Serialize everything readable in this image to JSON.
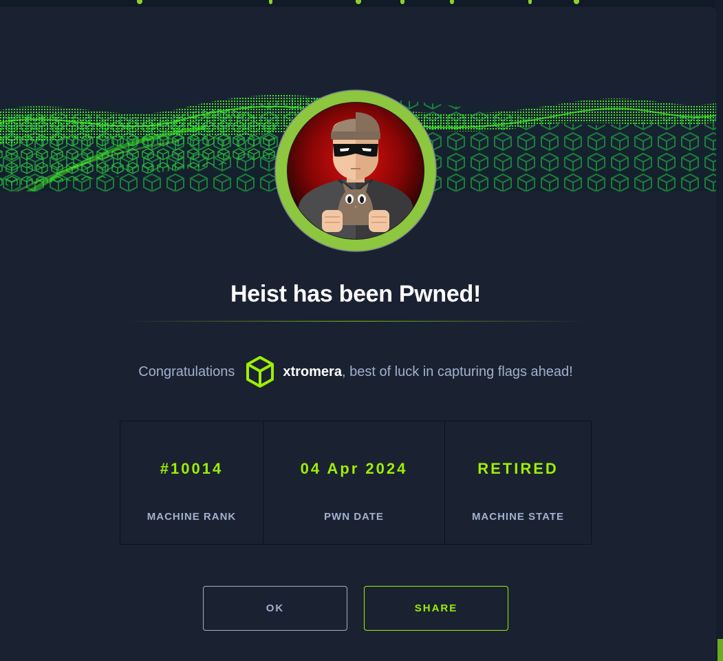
{
  "modal": {
    "title": "Heist has been Pwned!",
    "congrats_prefix": "Congratulations",
    "username": "xtromera",
    "congrats_suffix": ", best of luck in capturing flags ahead!"
  },
  "stats": [
    {
      "value": "#10014",
      "label": "MACHINE RANK"
    },
    {
      "value": "04 Apr 2024",
      "label": "PWN DATE"
    },
    {
      "value": "RETIRED",
      "label": "MACHINE STATE"
    }
  ],
  "buttons": {
    "ok_label": "OK",
    "share_label": "SHARE"
  },
  "icons": {
    "banner": "green-cube-wave-banner",
    "avatar": "heist-machine-avatar-thief-with-cat",
    "user": "hack-the-box-cube-icon"
  },
  "colors": {
    "accent": "#9fef00",
    "modal_background": "#1a2232",
    "page_background": "#0f1522",
    "muted_text": "#a4b1cd",
    "avatar_ring": "#8dc63f"
  }
}
